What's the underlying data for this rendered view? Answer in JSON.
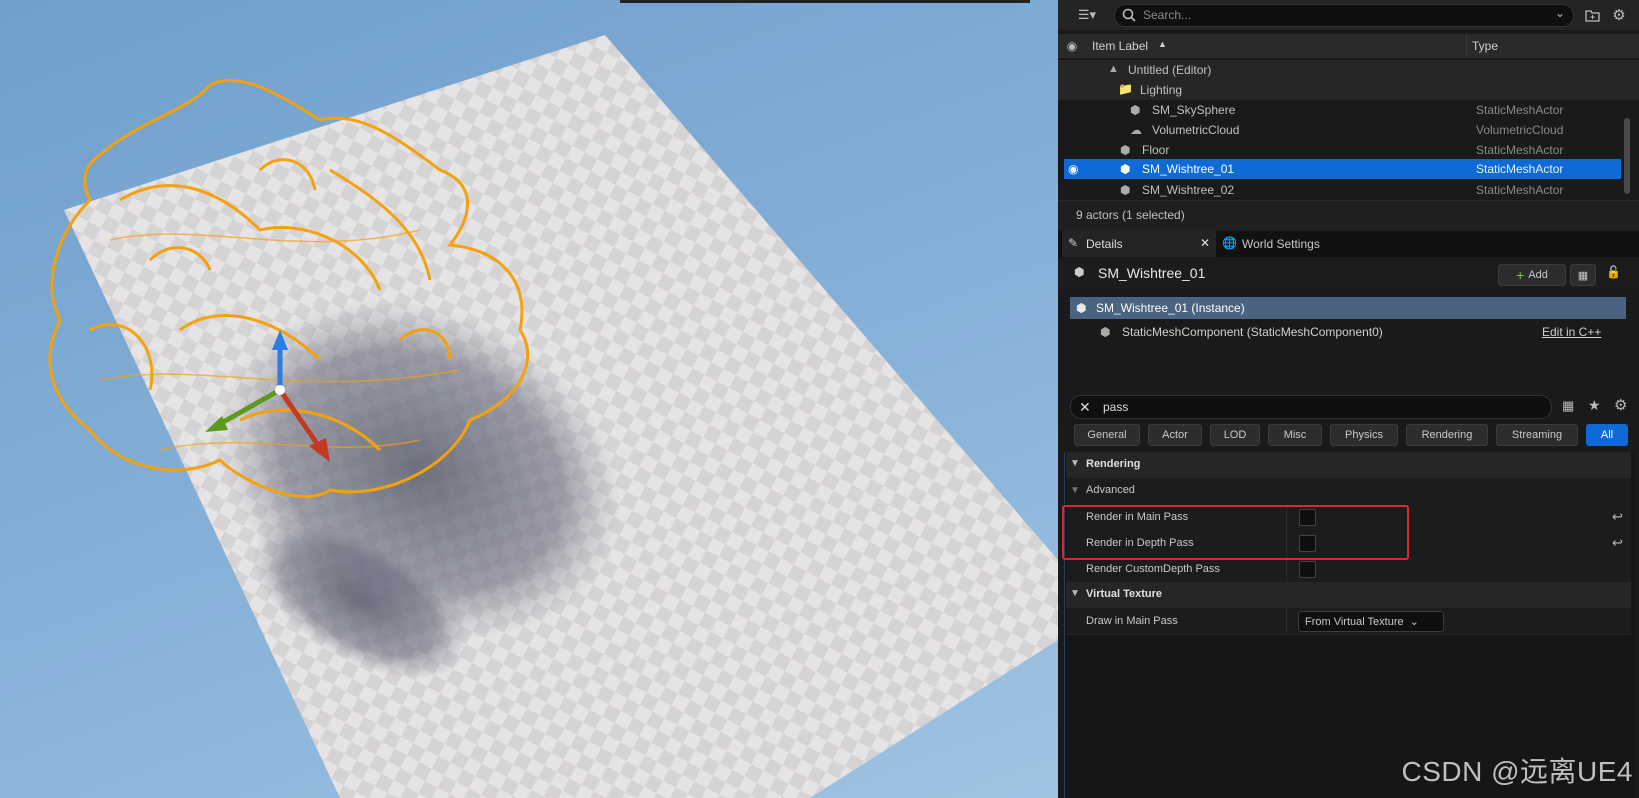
{
  "outliner": {
    "search_placeholder": "Search...",
    "columns": {
      "label": "Item Label",
      "type": "Type"
    },
    "items": [
      {
        "label": "Untitled (Editor)",
        "type": ""
      },
      {
        "label": "Lighting",
        "type": ""
      },
      {
        "label": "SM_SkySphere",
        "type": "StaticMeshActor"
      },
      {
        "label": "VolumetricCloud",
        "type": "VolumetricCloud"
      },
      {
        "label": "Floor",
        "type": "StaticMeshActor"
      },
      {
        "label": "SM_Wishtree_01",
        "type": "StaticMeshActor"
      },
      {
        "label": "SM_Wishtree_02",
        "type": "StaticMeshActor"
      }
    ],
    "status": "9 actors (1 selected)"
  },
  "tabs": {
    "details": "Details",
    "world_settings": "World Settings"
  },
  "details": {
    "actor_name": "SM_Wishtree_01",
    "add_label": "Add",
    "components": [
      {
        "label": "SM_Wishtree_01 (Instance)"
      },
      {
        "label": "StaticMeshComponent (StaticMeshComponent0)"
      }
    ],
    "edit_cpp": "Edit in C++",
    "search_value": "pass",
    "filters": [
      "General",
      "Actor",
      "LOD",
      "Misc",
      "Physics",
      "Rendering",
      "Streaming",
      "All"
    ],
    "sections": {
      "rendering": "Rendering",
      "advanced": "Advanced",
      "virtual_texture": "Virtual Texture"
    },
    "props": {
      "main_pass": "Render in Main Pass",
      "depth_pass": "Render in Depth Pass",
      "custom_depth": "Render CustomDepth Pass",
      "draw_main": "Draw in Main Pass",
      "draw_main_value": "From Virtual Texture"
    }
  },
  "watermark": "CSDN @远离UE4",
  "colors": {
    "selection": "#0d6ad6",
    "highlight_box": "#e0262b",
    "tree_outline": "#f2a20e"
  }
}
